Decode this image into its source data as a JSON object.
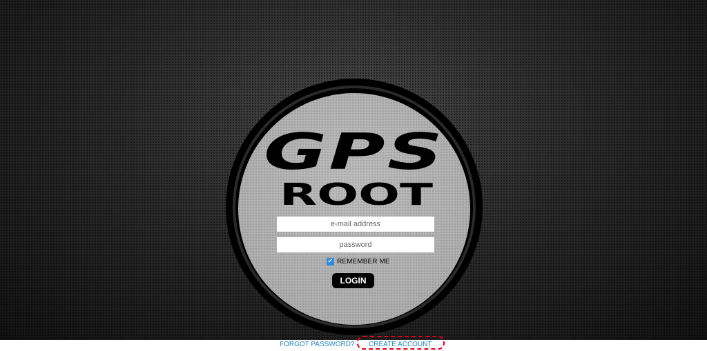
{
  "logo": {
    "line1": "GPS",
    "line2": "ROOT"
  },
  "login_form": {
    "email_placeholder": "e-mail address",
    "password_placeholder": "password",
    "remember_label": "REMEMBER ME",
    "remember_checked": true,
    "login_label": "LOGIN"
  },
  "footer": {
    "forgot_label": "FORGOT PASSWORD?",
    "create_label": "CREATE ACCOUNT"
  },
  "colors": {
    "link": "#2585c4",
    "checkbox": "#2c8ce0",
    "highlight": "#e0001b"
  },
  "icons": {
    "checkbox": "check-icon"
  }
}
